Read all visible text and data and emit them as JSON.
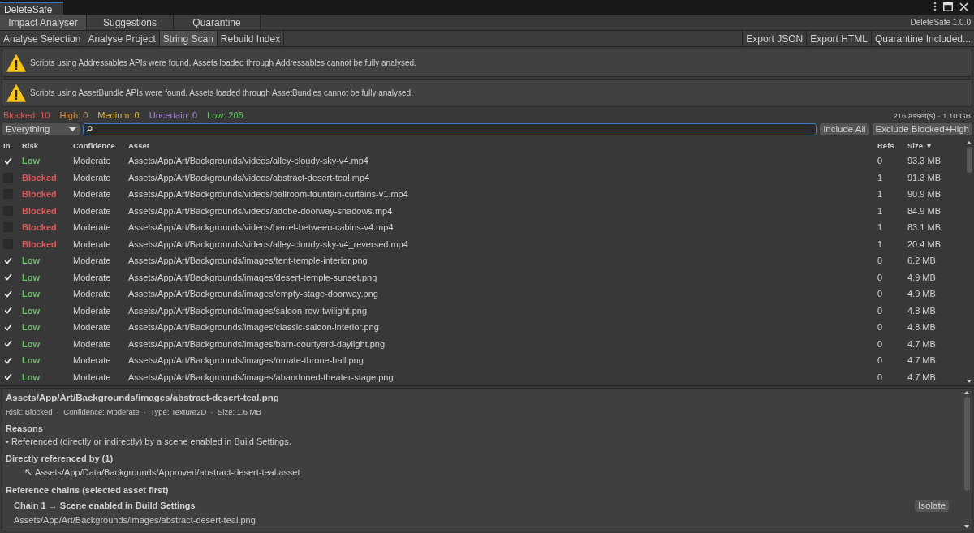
{
  "window": {
    "title": "DeleteSafe",
    "version": "DeleteSafe 1.0.0"
  },
  "tabs": [
    {
      "label": "Impact Analyser",
      "selected": true
    },
    {
      "label": "Suggestions",
      "selected": false
    },
    {
      "label": "Quarantine",
      "selected": false
    }
  ],
  "toolbar": {
    "left": [
      {
        "label": "Analyse Selection",
        "selected": false
      },
      {
        "label": "Analyse Project",
        "selected": false
      },
      {
        "label": "String Scan",
        "selected": true
      },
      {
        "label": "Rebuild Index",
        "selected": false
      }
    ],
    "right": [
      "Export JSON",
      "Export HTML",
      "Quarantine Included..."
    ]
  },
  "warnings": [
    "Scripts using Addressables APIs were found. Assets loaded through Addressables cannot be fully analysed.",
    "Scripts using AssetBundle APIs were found. Assets loaded through AssetBundles cannot be fully analysed."
  ],
  "counts": [
    {
      "label": "Blocked: 10",
      "color": "#d45b5b"
    },
    {
      "label": "High: 0",
      "color": "#d98a3d"
    },
    {
      "label": "Medium: 0",
      "color": "#d4b44a"
    },
    {
      "label": "Uncertain: 0",
      "color": "#a68ad6"
    },
    {
      "label": "Low: 206",
      "color": "#6cbf6a"
    }
  ],
  "summary": "216 asset(s) · 1.10 GB",
  "filter": {
    "value": "Everything"
  },
  "filter_buttons": [
    "Include All",
    "Exclude Blocked+High"
  ],
  "table": {
    "columns": [
      "In",
      "Risk",
      "Confidence",
      "Asset",
      "Refs",
      "Size"
    ],
    "sort_marker": "▼",
    "rows": [
      {
        "checked": true,
        "risk": "Low",
        "color": "#6cbf6a",
        "confidence": "Moderate",
        "asset": "Assets/App/Art/Backgrounds/videos/alley-cloudy-sky-v4.mp4",
        "refs": "0",
        "size": "93.3 MB"
      },
      {
        "checked": false,
        "risk": "Blocked",
        "color": "#d45b5b",
        "confidence": "Moderate",
        "asset": "Assets/App/Art/Backgrounds/videos/abstract-desert-teal.mp4",
        "refs": "1",
        "size": "91.3 MB"
      },
      {
        "checked": false,
        "risk": "Blocked",
        "color": "#d45b5b",
        "confidence": "Moderate",
        "asset": "Assets/App/Art/Backgrounds/videos/ballroom-fountain-curtains-v1.mp4",
        "refs": "1",
        "size": "90.9 MB"
      },
      {
        "checked": false,
        "risk": "Blocked",
        "color": "#d45b5b",
        "confidence": "Moderate",
        "asset": "Assets/App/Art/Backgrounds/videos/adobe-doorway-shadows.mp4",
        "refs": "1",
        "size": "84.9 MB"
      },
      {
        "checked": false,
        "risk": "Blocked",
        "color": "#d45b5b",
        "confidence": "Moderate",
        "asset": "Assets/App/Art/Backgrounds/videos/barrel-between-cabins-v4.mp4",
        "refs": "1",
        "size": "83.1 MB"
      },
      {
        "checked": false,
        "risk": "Blocked",
        "color": "#d45b5b",
        "confidence": "Moderate",
        "asset": "Assets/App/Art/Backgrounds/videos/alley-cloudy-sky-v4_reversed.mp4",
        "refs": "1",
        "size": "20.4 MB"
      },
      {
        "checked": true,
        "risk": "Low",
        "color": "#6cbf6a",
        "confidence": "Moderate",
        "asset": "Assets/App/Art/Backgrounds/images/tent-temple-interior.png",
        "refs": "0",
        "size": "6.2 MB"
      },
      {
        "checked": true,
        "risk": "Low",
        "color": "#6cbf6a",
        "confidence": "Moderate",
        "asset": "Assets/App/Art/Backgrounds/images/desert-temple-sunset.png",
        "refs": "0",
        "size": "4.9 MB"
      },
      {
        "checked": true,
        "risk": "Low",
        "color": "#6cbf6a",
        "confidence": "Moderate",
        "asset": "Assets/App/Art/Backgrounds/images/empty-stage-doorway.png",
        "refs": "0",
        "size": "4.9 MB"
      },
      {
        "checked": true,
        "risk": "Low",
        "color": "#6cbf6a",
        "confidence": "Moderate",
        "asset": "Assets/App/Art/Backgrounds/images/saloon-row-twilight.png",
        "refs": "0",
        "size": "4.8 MB"
      },
      {
        "checked": true,
        "risk": "Low",
        "color": "#6cbf6a",
        "confidence": "Moderate",
        "asset": "Assets/App/Art/Backgrounds/images/classic-saloon-interior.png",
        "refs": "0",
        "size": "4.8 MB"
      },
      {
        "checked": true,
        "risk": "Low",
        "color": "#6cbf6a",
        "confidence": "Moderate",
        "asset": "Assets/App/Art/Backgrounds/images/barn-courtyard-daylight.png",
        "refs": "0",
        "size": "4.7 MB"
      },
      {
        "checked": true,
        "risk": "Low",
        "color": "#6cbf6a",
        "confidence": "Moderate",
        "asset": "Assets/App/Art/Backgrounds/images/ornate-throne-hall.png",
        "refs": "0",
        "size": "4.7 MB"
      },
      {
        "checked": true,
        "risk": "Low",
        "color": "#6cbf6a",
        "confidence": "Moderate",
        "asset": "Assets/App/Art/Backgrounds/images/abandoned-theater-stage.png",
        "refs": "0",
        "size": "4.7 MB"
      }
    ]
  },
  "details": {
    "title": "Assets/App/Art/Backgrounds/images/abstract-desert-teal.png",
    "meta": "Risk: Blocked  ·  Confidence: Moderate  ·  Type: Texture2D  ·  Size: 1.6 MB",
    "reasons_heading": "Reasons",
    "reasons": [
      "• Referenced (directly or indirectly) by a scene enabled in Build Settings."
    ],
    "referenced_heading": "Directly referenced by (1)",
    "referenced": [
      "Assets/App/Data/Backgrounds/Approved/abstract-desert-teal.asset"
    ],
    "chains_heading": "Reference chains (selected asset first)",
    "chains": [
      {
        "title": "Chain 1 → Scene enabled in Build Settings",
        "button": "Isolate",
        "path": "Assets/App/Art/Backgrounds/images/abstract-desert-teal.png"
      }
    ]
  }
}
